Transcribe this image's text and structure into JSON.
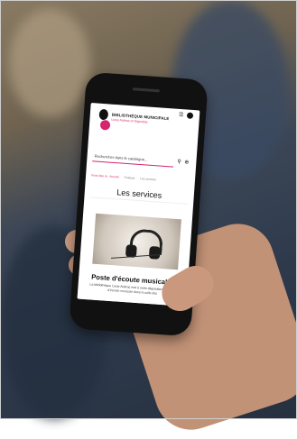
{
  "screen": {
    "brand": {
      "title": "BIBLIOTHÈQUE MUNICIPALE",
      "subtitle": "Lucie Aubrac et Gigondas"
    },
    "header_icons": [
      "list-icon",
      "user-icon"
    ],
    "search": {
      "placeholder": "Rechercher dans le catalogue..."
    },
    "search_icons": [
      "search-icon",
      "zoom-icon"
    ],
    "breadcrumb": [
      "Vous êtes ici : Accueil",
      "Pratique",
      "Les services"
    ],
    "page_title": "Les services",
    "section": {
      "title": "Poste d'écoute musicale :",
      "body": "La bibliothèque Lucie Aubrac met à votre disposition un poste d'écoute musicale dans la salle des"
    }
  },
  "colors": {
    "accent": "#d6246e",
    "phone_body": "#111111",
    "background_denim": "#2e3a4c"
  }
}
